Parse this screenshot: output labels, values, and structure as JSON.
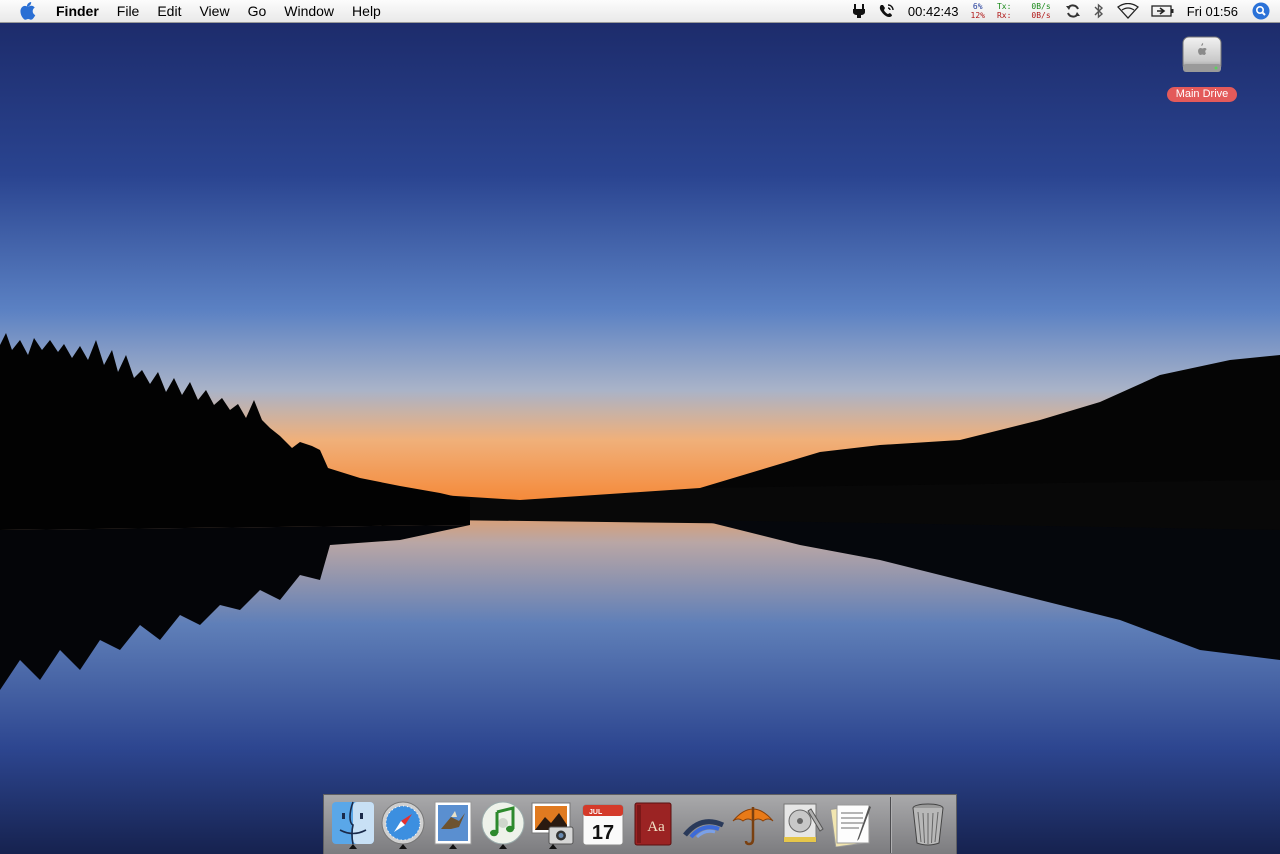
{
  "menubar": {
    "app_name": "Finder",
    "menus": [
      "File",
      "Edit",
      "View",
      "Go",
      "Window",
      "Help"
    ],
    "status": {
      "timer": "00:42:43",
      "cpu_top": "6%",
      "cpu_bottom": "12%",
      "tx_label": "Tx:",
      "rx_label": "Rx:",
      "tx_value": "0B/s",
      "rx_value": "0B/s",
      "clock": "Fri 01:56"
    },
    "icons": [
      "apple-icon",
      "menumeters-icon",
      "phone-icon",
      "sync-icon",
      "bluetooth-icon",
      "wifi-icon",
      "battery-icon",
      "spotlight-icon"
    ]
  },
  "desktop": {
    "drive_label": "Main Drive"
  },
  "dock": {
    "apps": [
      {
        "name": "Finder",
        "running": true
      },
      {
        "name": "Safari",
        "running": true
      },
      {
        "name": "Mail",
        "running": true
      },
      {
        "name": "iTunes",
        "running": true
      },
      {
        "name": "iPhoto",
        "running": true
      },
      {
        "name": "iCal",
        "running": false
      },
      {
        "name": "Dictionary",
        "running": false
      },
      {
        "name": "Network",
        "running": false
      },
      {
        "name": "Umbrella",
        "running": false
      },
      {
        "name": "Disk Utility",
        "running": false
      },
      {
        "name": "TextEdit",
        "running": false
      },
      {
        "name": "Trash",
        "running": false
      }
    ],
    "ical_month": "JUL",
    "ical_day": "17",
    "dictionary_text": "Aa"
  },
  "colors": {
    "sky_top": "#1c2a66",
    "sky_mid": "#4b6fb4",
    "horizon": "#f08a3c",
    "label_red": "#e35a5a"
  }
}
